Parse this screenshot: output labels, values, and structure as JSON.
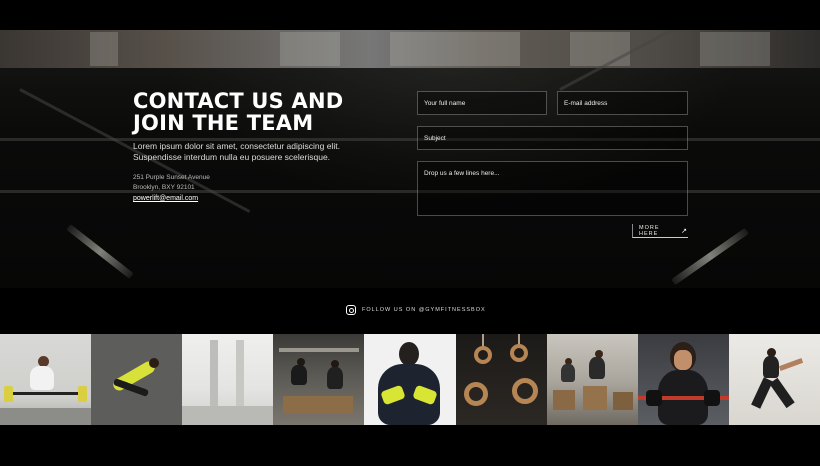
{
  "contact": {
    "title": "CONTACT US AND\nJOIN THE TEAM",
    "lead": "Lorem ipsum dolor sit amet, consectetur adipiscing elit. Suspendisse interdum nulla eu posuere scelerisque.",
    "address_line1": "251 Purple Sunset Avenue",
    "address_line2": "Brooklyn, BXY 92101",
    "email": "powerlift@email.com"
  },
  "form": {
    "name_placeholder": "Your full name",
    "email_placeholder": "E-mail address",
    "subject_placeholder": "Subject",
    "message_placeholder": "Drop us a few lines here...",
    "submit_label": "MORE HERE",
    "submit_icon": "arrow-up-right-icon"
  },
  "follow": {
    "icon": "instagram-icon",
    "text": "FOLLOW US ON @GYMFITNESSBOX"
  },
  "gallery": [
    {
      "name": "barbell-deadlift-photo"
    },
    {
      "name": "floor-exercise-photo"
    },
    {
      "name": "empty-gym-photo"
    },
    {
      "name": "box-jump-group-photo"
    },
    {
      "name": "athlete-portrait-photo"
    },
    {
      "name": "gymnastic-rings-photo"
    },
    {
      "name": "box-jump-class-photo"
    },
    {
      "name": "battle-rope-photo"
    },
    {
      "name": "runner-photo"
    }
  ],
  "colors": {
    "background": "#000000",
    "text": "#ffffff",
    "field_border": "#4a4a4a"
  }
}
